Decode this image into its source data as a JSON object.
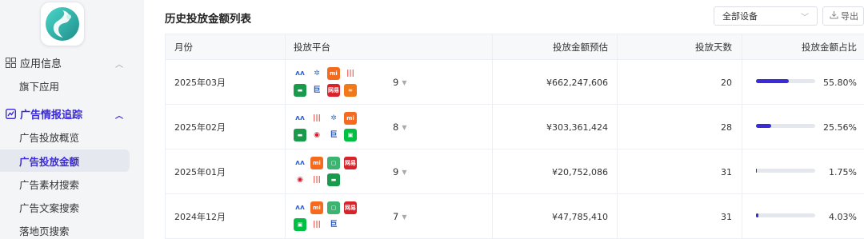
{
  "sidebar": {
    "groups": [
      {
        "label": "应用信息",
        "icon": "grid-icon",
        "expanded": false
      },
      {
        "label": "广告情报追踪",
        "icon": "ad-chart-icon",
        "expanded": true
      }
    ],
    "items": [
      {
        "label": "旗下应用"
      },
      {
        "label": "广告投放概览"
      },
      {
        "label": "广告投放金额",
        "active": true
      },
      {
        "label": "广告素材搜索"
      },
      {
        "label": "广告文案搜索"
      },
      {
        "label": "落地页搜索"
      }
    ]
  },
  "main": {
    "title": "历史投放金额列表",
    "device_select": {
      "value": "全部设备"
    },
    "export_label": "导出",
    "columns": [
      "月份",
      "投放平台",
      "投放金额预估",
      "投放天数",
      "投放金额占比"
    ],
    "rows": [
      {
        "month": "2025年03月",
        "platforms": [
          "baidu",
          "wind",
          "xiaomi",
          "iqiyi-c",
          "tencent",
          "jv",
          "netease",
          "moji"
        ],
        "platform_count": "9",
        "amount": "¥662,247,606",
        "days": "20",
        "share": 0.558,
        "share_label": "55.80%"
      },
      {
        "month": "2025年02月",
        "platforms": [
          "baidu",
          "iqiyi-c",
          "wind",
          "xiaomi",
          "tencent",
          "weibo",
          "jv",
          "iqiyi"
        ],
        "platform_count": "8",
        "amount": "¥303,361,424",
        "days": "28",
        "share": 0.2556,
        "share_label": "25.56%"
      },
      {
        "month": "2025年01月",
        "platforms": [
          "baidu",
          "xiaomi",
          "square",
          "netease",
          "weibo",
          "iqiyi-c",
          "tencent"
        ],
        "platform_count": "9",
        "amount": "¥20,752,086",
        "days": "31",
        "share": 0.0175,
        "share_label": "1.75%"
      },
      {
        "month": "2024年12月",
        "platforms": [
          "baidu",
          "xiaomi",
          "square",
          "netease",
          "iqiyi",
          "iqiyi-c",
          "jv"
        ],
        "platform_count": "7",
        "amount": "¥47,785,410",
        "days": "31",
        "share": 0.0403,
        "share_label": "4.03%"
      }
    ]
  },
  "platform_icons": {
    "baidu": {
      "name": "baidu-ad-icon",
      "bg": "#ffffff",
      "fg": "#2a63d8",
      "glyph": "ʌʌ"
    },
    "wind": {
      "name": "paw-icon",
      "bg": "#ffffff",
      "fg": "#2b6fe0",
      "glyph": "✲"
    },
    "xiaomi": {
      "name": "xiaomi-icon",
      "bg": "#f46b1f",
      "fg": "#ffffff",
      "glyph": "mi"
    },
    "iqiyi-c": {
      "name": "bars-icon",
      "bg": "#ffffff",
      "fg": "#e8453c",
      "glyph": "|||"
    },
    "tencent": {
      "name": "tencent-ad-icon",
      "bg": "#1a9a4b",
      "fg": "#ffffff",
      "glyph": "▬"
    },
    "jv": {
      "name": "jv-icon",
      "bg": "#ffffff",
      "fg": "#1e4fb3",
      "glyph": "巨"
    },
    "netease": {
      "name": "netease-icon",
      "bg": "#d9232a",
      "fg": "#ffffff",
      "glyph": "网易"
    },
    "moji": {
      "name": "moji-icon",
      "bg": "#f07a1a",
      "fg": "#ffffff",
      "glyph": "∞"
    },
    "weibo": {
      "name": "weibo-icon",
      "bg": "#ffffff",
      "fg": "#e6162d",
      "glyph": "◉"
    },
    "iqiyi": {
      "name": "iqiyi-icon",
      "bg": "#00c043",
      "fg": "#ffffff",
      "glyph": "▣"
    },
    "square": {
      "name": "square-app-icon",
      "bg": "#3cb371",
      "fg": "#ffffff",
      "glyph": "▢"
    }
  },
  "colors": {
    "accent": "#3b2ad8",
    "bar_track": "#e5e7ef"
  }
}
